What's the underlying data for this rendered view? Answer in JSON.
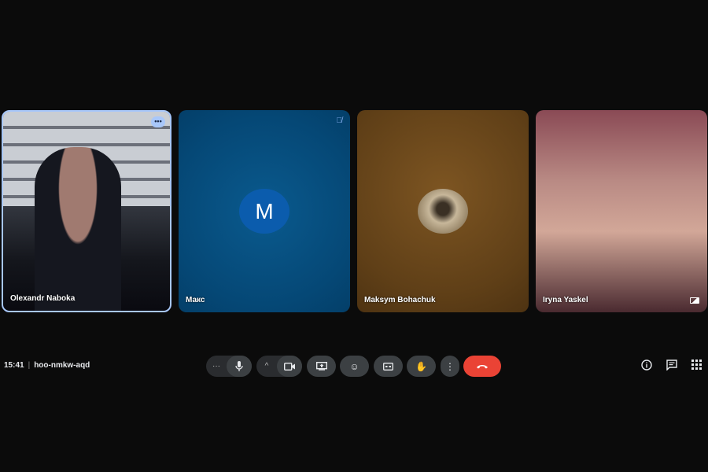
{
  "participants": [
    {
      "name": "Olexandr Naboka",
      "type": "video"
    },
    {
      "name": "Макс",
      "type": "avatar",
      "initial": "M",
      "muted": true
    },
    {
      "name": "Maksym Bohachuk",
      "type": "photo"
    },
    {
      "name": "Iryna Yaskel",
      "type": "video"
    }
  ],
  "meeting": {
    "time": "15:41",
    "separator": "|",
    "code": "hoo-nmkw-aqd"
  },
  "colors": {
    "end_call": "#ea4335",
    "active_border": "#a8c7fa",
    "avatar_bg": "#0b5cad"
  }
}
